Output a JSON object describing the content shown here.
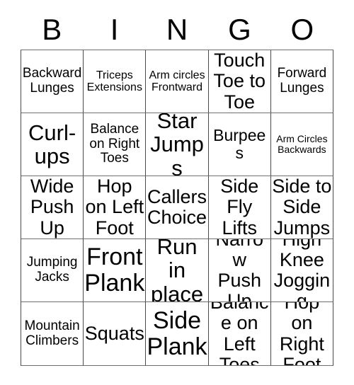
{
  "card": {
    "title": "BINGO",
    "header_letters": [
      "B",
      "I",
      "N",
      "G",
      "O"
    ],
    "columns": 5,
    "rows": 5,
    "colors": {
      "background": "#ffffff",
      "text": "#000000",
      "grid_line": "#4a4a4a",
      "grid_line_light": "#6f6f6f"
    },
    "cells": [
      [
        {
          "text": "Backward Lunges",
          "size": "md"
        },
        {
          "text": "Triceps Extensions",
          "size": "sm"
        },
        {
          "text": "Arm circles Frontward",
          "size": "sm"
        },
        {
          "text": "Touch Toe to Toe",
          "size": "xl"
        },
        {
          "text": "Forward Lunges",
          "size": "md"
        }
      ],
      [
        {
          "text": "Curl-ups",
          "size": "xxl"
        },
        {
          "text": "Balance on Right Toes",
          "size": "md"
        },
        {
          "text": "Star Jumps",
          "size": "xxl"
        },
        {
          "text": "Burpees",
          "size": "lg"
        },
        {
          "text": "Arm Circles Backwards",
          "size": "xs"
        }
      ],
      [
        {
          "text": "Wide Push Up",
          "size": "xl"
        },
        {
          "text": "Hop on Left Foot",
          "size": "xl"
        },
        {
          "text": "Callers Choice",
          "size": "xl"
        },
        {
          "text": "Side Fly Lifts",
          "size": "xl"
        },
        {
          "text": "Side to Side Jumps",
          "size": "xl"
        }
      ],
      [
        {
          "text": "Jumping Jacks",
          "size": "md"
        },
        {
          "text": "Front Plank",
          "size": "xxxl"
        },
        {
          "text": "Run in place",
          "size": "xxl"
        },
        {
          "text": "Narrow Push Up",
          "size": "xl"
        },
        {
          "text": "High Knee Jogging",
          "size": "xl"
        }
      ],
      [
        {
          "text": "Mountain Climbers",
          "size": "md"
        },
        {
          "text": "Squats",
          "size": "xl"
        },
        {
          "text": "Side Plank",
          "size": "xxxl"
        },
        {
          "text": "Balance on Left Toes",
          "size": "xl"
        },
        {
          "text": "Hop on Right Foot",
          "size": "xl"
        }
      ]
    ]
  }
}
